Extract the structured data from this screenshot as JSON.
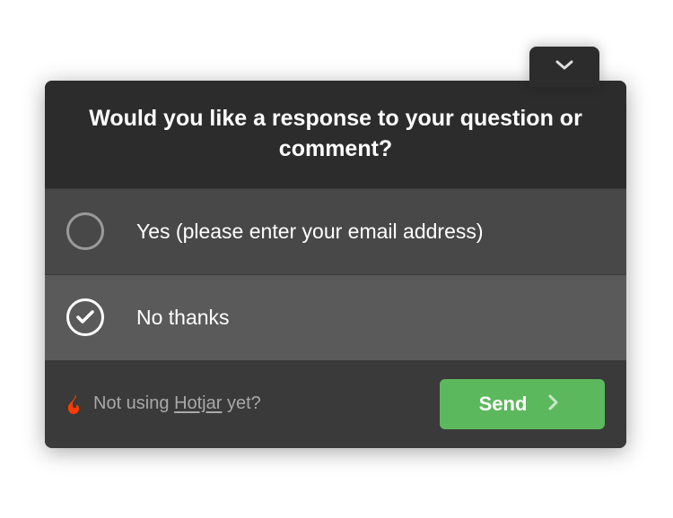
{
  "header": {
    "title": "Would you like a response to your question or comment?"
  },
  "options": {
    "yes": {
      "label": "Yes (please enter your email address)",
      "selected": false
    },
    "no": {
      "label": "No thanks",
      "selected": true
    }
  },
  "footer": {
    "brand_prefix": "Not using ",
    "brand_name": "Hotjar",
    "brand_suffix": " yet?",
    "send_label": "Send"
  },
  "colors": {
    "accent_green": "#5cb85c",
    "flame": "#ff3c00"
  }
}
